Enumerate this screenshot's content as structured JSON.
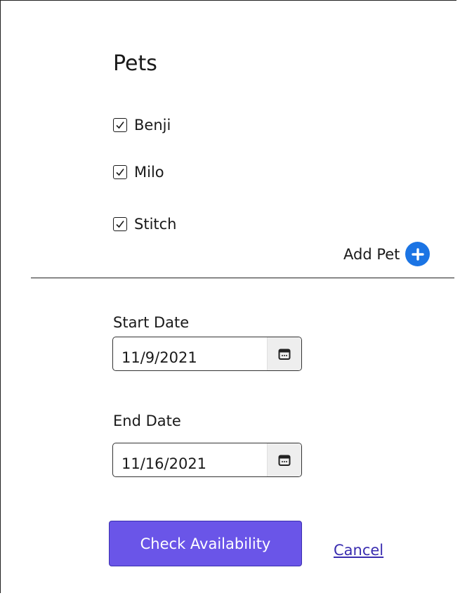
{
  "pets_section": {
    "title": "Pets",
    "pets": [
      {
        "name": "Benji",
        "checked": true
      },
      {
        "name": "Milo",
        "checked": true
      },
      {
        "name": "Stitch",
        "checked": true
      }
    ],
    "add_pet_label": "Add Pet",
    "add_icon": "plus-circle-icon"
  },
  "dates": {
    "start_label": "Start Date",
    "start_value": "11/9/2021",
    "end_label": "End Date",
    "end_value": "11/16/2021",
    "calendar_icon": "calendar-icon"
  },
  "actions": {
    "check_label": "Check Availability",
    "cancel_label": "Cancel"
  },
  "colors": {
    "primary_button": "#6a55e8",
    "add_icon": "#1b74e4",
    "link": "#3a2db0"
  }
}
